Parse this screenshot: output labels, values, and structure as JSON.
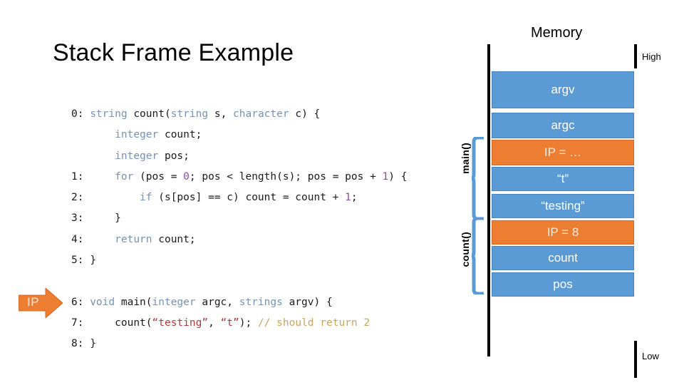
{
  "slide": {
    "title": "Stack Frame Example"
  },
  "memory": {
    "heading": "Memory",
    "high_label": "High",
    "low_label": "Low",
    "colors": {
      "blue": "#5B9BD5",
      "orange": "#ED7D31",
      "text_on_box": "#FFFFFF"
    },
    "boxes": [
      {
        "label": "argv",
        "color": "blue"
      },
      {
        "label": "argc",
        "color": "blue"
      },
      {
        "label": "IP = …",
        "color": "orange"
      },
      {
        "label": "“t”",
        "color": "blue"
      },
      {
        "label": "“testing”",
        "color": "blue"
      },
      {
        "label": "IP = 8",
        "color": "orange"
      },
      {
        "label": "count",
        "color": "blue"
      },
      {
        "label": "pos",
        "color": "blue"
      }
    ],
    "frames": [
      {
        "label": "main()"
      },
      {
        "label": "count()"
      }
    ]
  },
  "pointer": {
    "ip_label": "IP"
  },
  "code": {
    "lines": [
      {
        "number": "0:",
        "indent": 0,
        "tokens": [
          {
            "t": "string",
            "c": "kw"
          },
          {
            "t": " ",
            "c": "pl"
          },
          {
            "t": "count(",
            "c": "pl"
          },
          {
            "t": "string",
            "c": "kw"
          },
          {
            "t": " s, ",
            "c": "pl"
          },
          {
            "t": "character",
            "c": "kw"
          },
          {
            "t": " c) {",
            "c": "pl"
          }
        ]
      },
      {
        "number": "",
        "indent": 1,
        "tokens": [
          {
            "t": "integer",
            "c": "kw"
          },
          {
            "t": " count;",
            "c": "pl"
          }
        ]
      },
      {
        "number": "",
        "indent": 1,
        "tokens": [
          {
            "t": "integer",
            "c": "kw"
          },
          {
            "t": " pos;",
            "c": "pl"
          }
        ]
      },
      {
        "number": "1:",
        "indent": 1,
        "tokens": [
          {
            "t": "for",
            "c": "kw"
          },
          {
            "t": " (pos = ",
            "c": "pl"
          },
          {
            "t": "0",
            "c": "num"
          },
          {
            "t": "; pos < length(s); pos = pos + ",
            "c": "pl"
          },
          {
            "t": "1",
            "c": "num"
          },
          {
            "t": ") {",
            "c": "pl"
          }
        ]
      },
      {
        "number": "2:",
        "indent": 2,
        "tokens": [
          {
            "t": "if",
            "c": "kw"
          },
          {
            "t": " (s[pos] == c) count = count + ",
            "c": "pl"
          },
          {
            "t": "1",
            "c": "num"
          },
          {
            "t": ";",
            "c": "pl"
          }
        ]
      },
      {
        "number": "3:",
        "indent": 1,
        "tokens": [
          {
            "t": "}",
            "c": "pl"
          }
        ]
      },
      {
        "number": "4:",
        "indent": 1,
        "tokens": [
          {
            "t": "return",
            "c": "kw"
          },
          {
            "t": " count;",
            "c": "pl"
          }
        ]
      },
      {
        "number": "5:",
        "indent": 0,
        "tokens": [
          {
            "t": "}",
            "c": "pl"
          }
        ]
      },
      {
        "number": "",
        "indent": 0,
        "tokens": []
      },
      {
        "number": "6:",
        "indent": 0,
        "tokens": [
          {
            "t": "void",
            "c": "kw"
          },
          {
            "t": " main(",
            "c": "pl"
          },
          {
            "t": "integer",
            "c": "kw"
          },
          {
            "t": " argc, ",
            "c": "pl"
          },
          {
            "t": "strings",
            "c": "kw"
          },
          {
            "t": " argv) {",
            "c": "pl"
          }
        ]
      },
      {
        "number": "7:",
        "indent": 1,
        "tokens": [
          {
            "t": "count(",
            "c": "pl"
          },
          {
            "t": "“testing”",
            "c": "str"
          },
          {
            "t": ", ",
            "c": "pl"
          },
          {
            "t": "“t”",
            "c": "str"
          },
          {
            "t": "); ",
            "c": "pl"
          },
          {
            "t": "// should return 2",
            "c": "com"
          }
        ]
      },
      {
        "number": "8:",
        "indent": 0,
        "tokens": [
          {
            "t": "}",
            "c": "pl"
          }
        ]
      }
    ]
  }
}
